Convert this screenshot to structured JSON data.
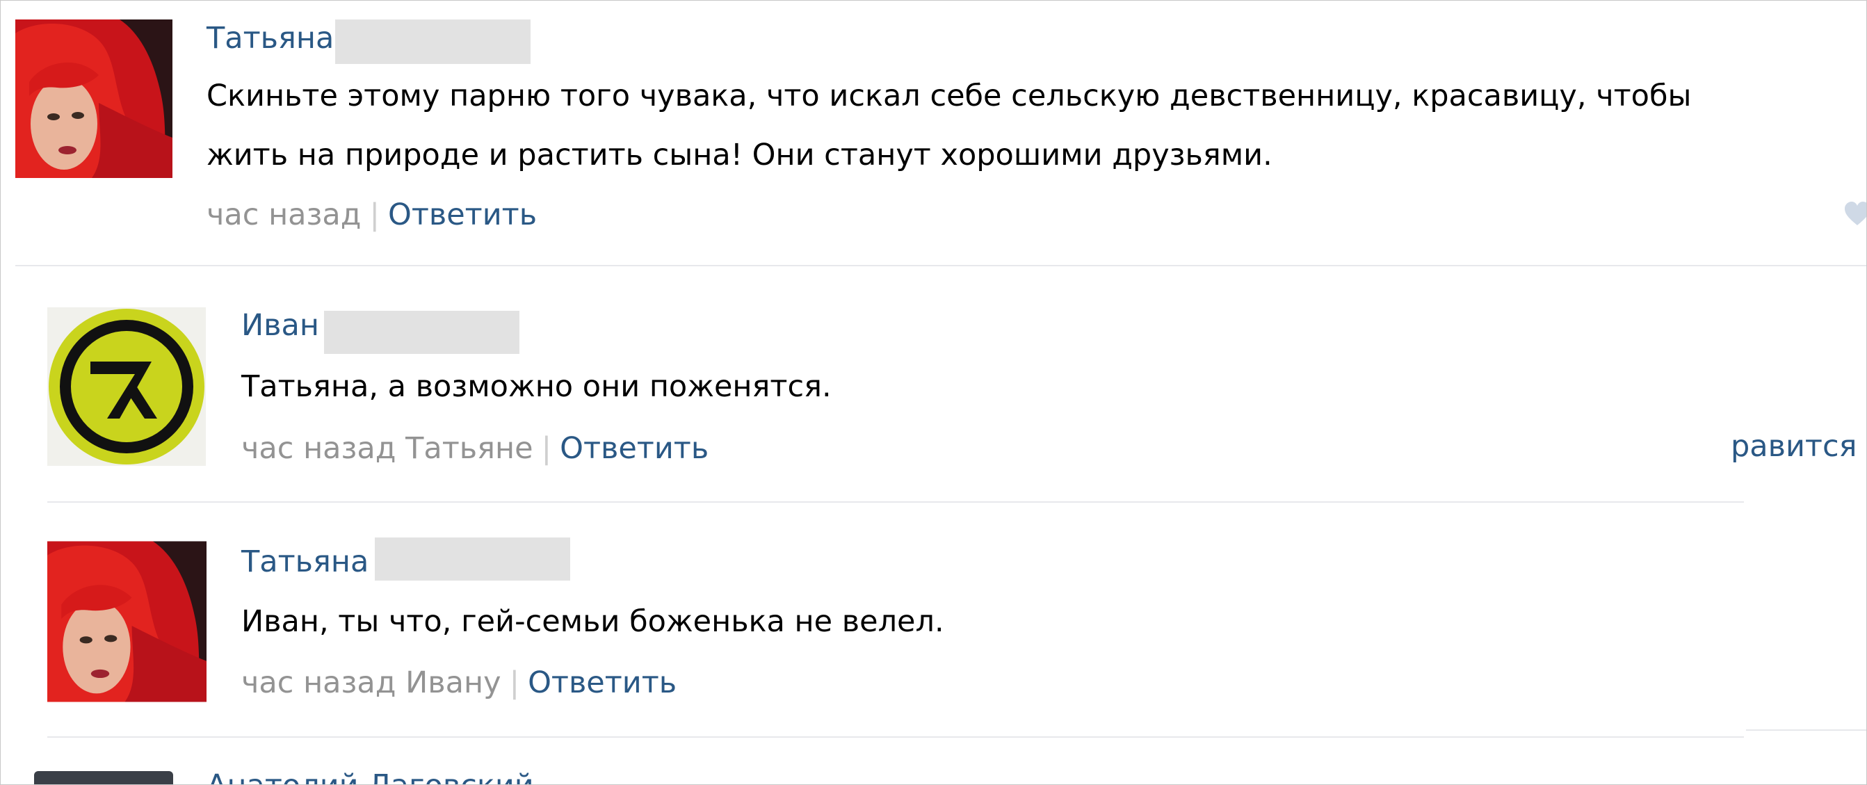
{
  "comments": [
    {
      "author": "Татьяна",
      "text_lines": [
        "Скиньте этому парню того чувака, что искал себе сельскую девственницу, красавицу, чтобы",
        "жить на природе и растить сына! Они станут хорошими друзьями."
      ],
      "time": "час назад",
      "separator": "|",
      "reply_label": "Ответить"
    },
    {
      "author": "Иван",
      "text": "Татьяна, а возможно они поженятся.",
      "time": "час назад Татьяне",
      "separator": "|",
      "reply_label": "Ответить",
      "like_fragment": "равится"
    },
    {
      "author": "Татьяна",
      "text": "Иван, ты что, гей-семьи боженька не велел.",
      "time": "час назад Ивану",
      "separator": "|",
      "reply_label": "Ответить"
    },
    {
      "author": "Анатолий Лаговский"
    }
  ],
  "colors": {
    "link": "#2a5885",
    "meta": "#939393",
    "divider": "#e7e8ec",
    "redaction": "#e2e2e2"
  }
}
